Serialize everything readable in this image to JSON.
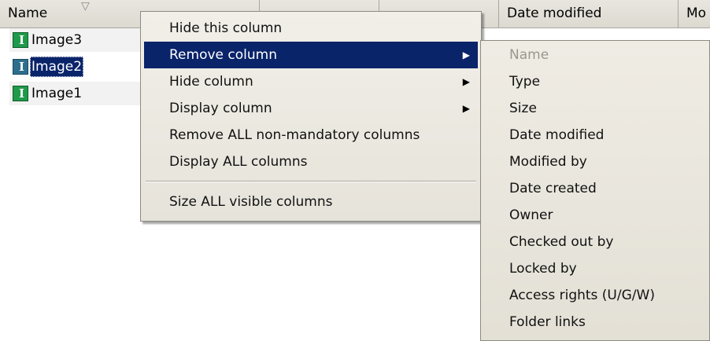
{
  "grid": {
    "headers": [
      "Name",
      "",
      "",
      "Date modified",
      "Mo"
    ],
    "sort_icon": "sort-descending-icon",
    "rows": [
      {
        "name": "Image3",
        "icon": "image-file-icon",
        "selected": false
      },
      {
        "name": "Image2",
        "icon": "image-file-icon",
        "selected": true
      },
      {
        "name": "Image1",
        "icon": "image-file-icon",
        "selected": false
      }
    ]
  },
  "context_menu": {
    "items": [
      {
        "label": "Hide this column",
        "submenu": false
      },
      {
        "label": "Remove column",
        "submenu": true,
        "active": true
      },
      {
        "label": "Hide column",
        "submenu": true
      },
      {
        "label": "Display column",
        "submenu": true
      },
      {
        "label": "Remove ALL non-mandatory columns",
        "submenu": false
      },
      {
        "label": "Display ALL columns",
        "submenu": false
      },
      {
        "label": "Size ALL visible columns",
        "submenu": false
      }
    ]
  },
  "submenu": {
    "items": [
      {
        "label": "Name",
        "disabled": true
      },
      {
        "label": "Type",
        "disabled": false
      },
      {
        "label": "Size",
        "disabled": false
      },
      {
        "label": "Date modified",
        "disabled": false
      },
      {
        "label": "Modified by",
        "disabled": false
      },
      {
        "label": "Date created",
        "disabled": false
      },
      {
        "label": "Owner",
        "disabled": false
      },
      {
        "label": "Checked out by",
        "disabled": false
      },
      {
        "label": "Locked by",
        "disabled": false
      },
      {
        "label": "Access rights (U/G/W)",
        "disabled": false
      },
      {
        "label": "Folder links",
        "disabled": false
      }
    ]
  },
  "colors": {
    "highlight": "#0a246a",
    "menu_bg": "#ece9d8",
    "icon_green": "#1f9a4a"
  }
}
